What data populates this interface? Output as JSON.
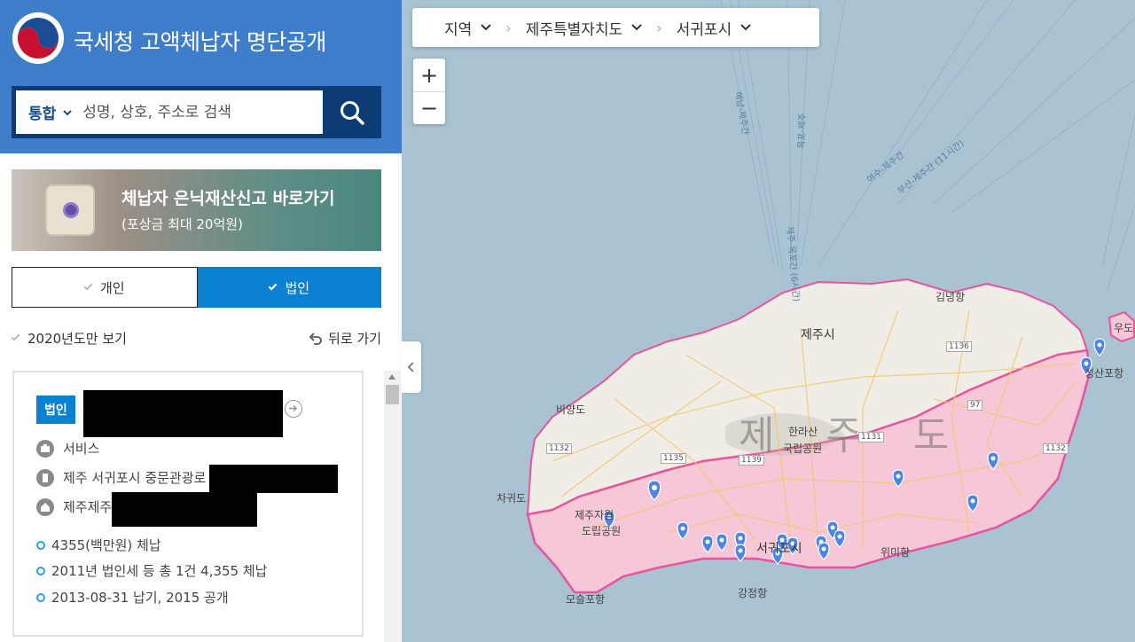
{
  "header": {
    "title": "국세청 고액체납자 명단공개"
  },
  "search": {
    "scope": "통합",
    "placeholder": "성명, 상호, 주소로 검색"
  },
  "banner": {
    "title": "체납자 은닉재산신고 바로가기",
    "subtitle": "(포상금 최대 20억원)"
  },
  "segment": {
    "individual": "개인",
    "corporate": "법인",
    "active": "corporate"
  },
  "filters": {
    "year_only": "2020년도만 보기",
    "back": "뒤로 가기"
  },
  "card": {
    "badge": "법인",
    "category": "서비스",
    "address_road": "제주 서귀포시 중문관광로",
    "address_lot": "제주제주",
    "amount": "4355(백만원) 체납",
    "detail": "2011년 법인세 등 총 1건 4,355 체납",
    "dates": "2013-08-31 납기, 2015 공개"
  },
  "breadcrumb": [
    "지역",
    "제주특별자치도",
    "서귀포시"
  ],
  "zoom": {
    "in": "+",
    "out": "−"
  },
  "map_labels": {
    "island": "제 주 도",
    "jeju_city": "제주시",
    "seogwipo": "서귀포시",
    "hallasan": "한라산",
    "hallasan_park": "국립공원",
    "gimnyeong": "김녕항",
    "biyangdo": "비양도",
    "chagwido": "차귀도",
    "wimi": "위미항",
    "gangjeong": "강정항",
    "moseulpo": "모슬포항",
    "seongsanpo": "성산포항",
    "udo": "우도",
    "forest1": "제주자월",
    "forest2": "도립공원",
    "route_1": "여수-제주간",
    "route_2": "부산-제주간 (11시간)",
    "route_3": "목포-제주",
    "route_4": "해남-제주간",
    "route_5": "제주-목포간 (6시간)"
  },
  "road_numbers": [
    "1132",
    "1135",
    "1139",
    "1131",
    "1136",
    "97",
    "1132"
  ],
  "colors": {
    "header": "#3d7dc9",
    "accent": "#0a82d1",
    "region_fill": "#f6c7d7",
    "region_border": "#e8559a",
    "marker": "#4a86e8"
  }
}
